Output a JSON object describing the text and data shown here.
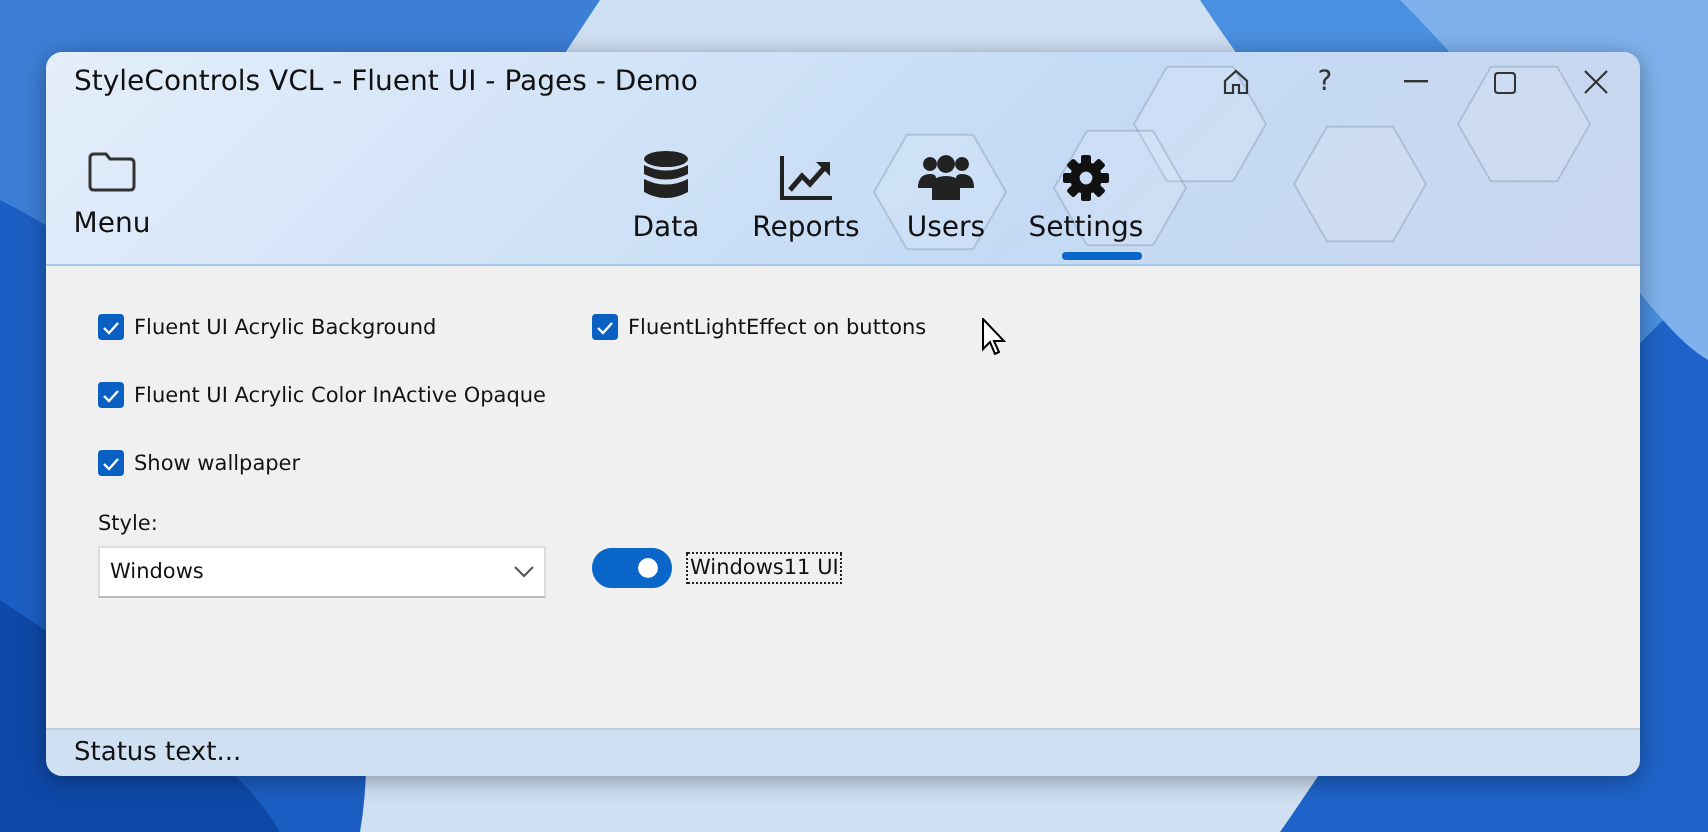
{
  "window": {
    "title": "StyleControls VCL - Fluent UI - Pages - Demo",
    "help_button": "?"
  },
  "menu_button": {
    "label": "Menu"
  },
  "tabs": [
    {
      "label": "Data",
      "selected": false
    },
    {
      "label": "Reports",
      "selected": false
    },
    {
      "label": "Users",
      "selected": false
    },
    {
      "label": "Settings",
      "selected": true
    }
  ],
  "left_options": [
    {
      "label": "Fluent UI Acrylic Background",
      "checked": true
    },
    {
      "label": "Fluent UI Acrylic Color InActive Opaque",
      "checked": true
    },
    {
      "label": "Show wallpaper",
      "checked": true
    }
  ],
  "right_options": [
    {
      "label": "FluentLightEffect on buttons",
      "checked": true
    }
  ],
  "style_label": "Style:",
  "style_select": {
    "value": "Windows"
  },
  "toggle": {
    "label": "Windows11 UI",
    "on": true,
    "focused": true
  },
  "status_bar": "Status text..."
}
